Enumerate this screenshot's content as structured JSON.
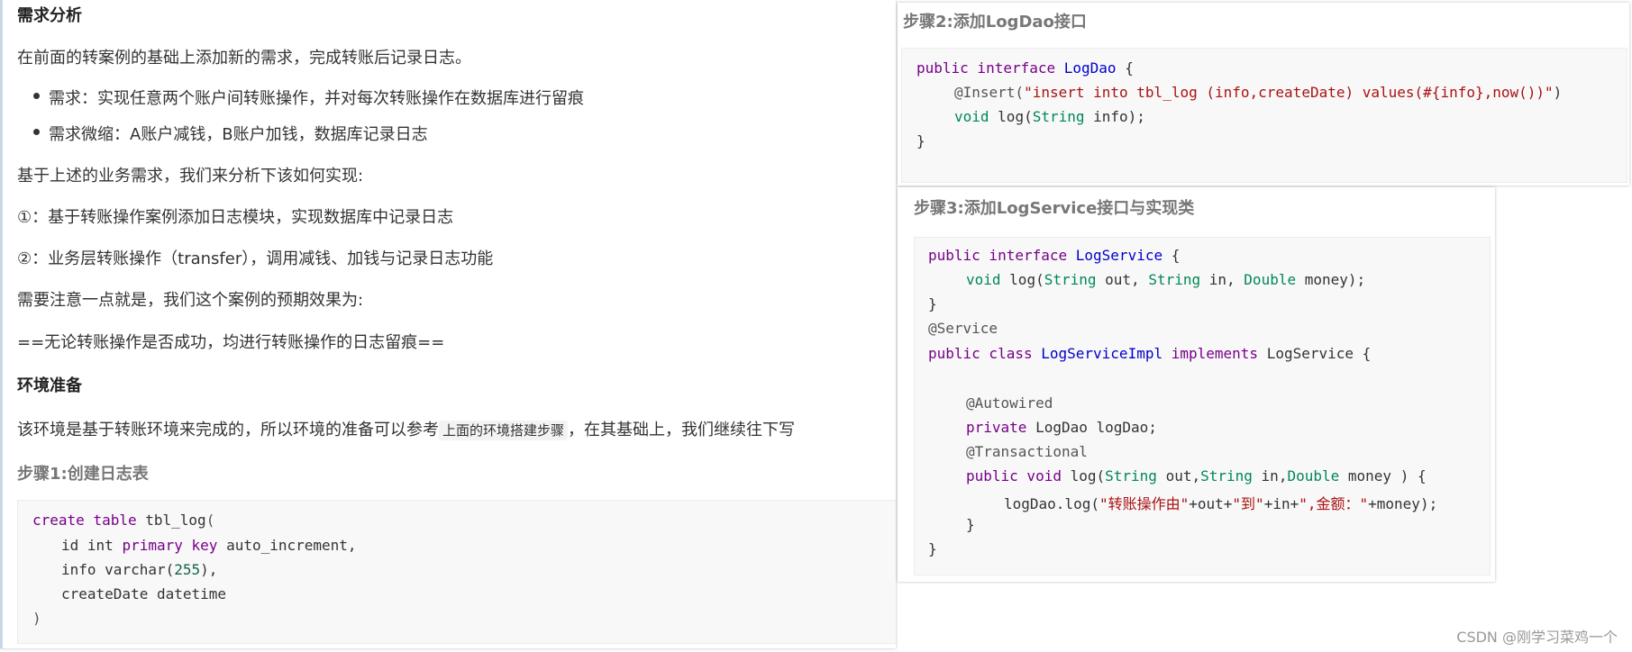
{
  "left": {
    "section_title": "需求分析",
    "intro": "在前面的转案例的基础上添加新的需求，完成转账后记录日志。",
    "bullets": [
      "需求：实现任意两个账户间转账操作，并对每次转账操作在数据库进行留痕",
      "需求微缩：A账户减钱，B账户加钱，数据库记录日志"
    ],
    "analysis_intro": "基于上述的业务需求，我们来分析下该如何实现:",
    "steps": [
      "①：基于转账操作案例添加日志模块，实现数据库中记录日志",
      "②：业务层转账操作（transfer），调用减钱、加钱与记录日志功能"
    ],
    "note_intro": "需要注意一点就是，我们这个案例的预期效果为:",
    "highlight": "==无论转账操作是否成功，均进行转账操作的日志留痕==",
    "env_title": "环境准备",
    "env_text_pre": "该环境是基于转账环境来完成的，所以环境的准备可以参考",
    "env_text_code": "上面的环境搭建步骤",
    "env_text_post": "，在其基础上，我们继续往下写",
    "step1_title": "步骤1:创建日志表",
    "sql": {
      "l1_kw1": "create",
      "l1_kw2": "table",
      "l1_name": "tbl_log",
      "l1_paren": "(",
      "l2_col": "id",
      "l2_type": "int",
      "l2_kw": "primary key",
      "l2_rest": "auto_increment,",
      "l3_col": "info",
      "l3_type": "varchar(",
      "l3_num": "255",
      "l3_close": "),",
      "l4": "createDate datetime",
      "l5": ")"
    }
  },
  "right_top": {
    "title": "步骤2:添加LogDao接口",
    "code": {
      "l1_kw": "public interface",
      "l1_name": "LogDao",
      "l1_brace": "{",
      "l2_ann": "@Insert(",
      "l2_str": "\"insert into tbl_log (info,createDate) values(#{info},now())\"",
      "l2_close": ")",
      "l3_kw": "void",
      "l3_rest": "log(",
      "l3_type": "String",
      "l3_end": "info);",
      "l4": "}"
    }
  },
  "right_mid": {
    "title": "步骤3:添加LogService接口与实现类",
    "code": {
      "l1_kw": "public interface",
      "l1_name": "LogService",
      "l1_brace": "{",
      "l2_kw": "void",
      "l2_a": "log(",
      "l2_t1": "String",
      "l2_b": "out,",
      "l2_t2": "String",
      "l2_c": "in,",
      "l2_t3": "Double",
      "l2_d": "money);",
      "l3": "}",
      "l4": "@Service",
      "l5_kw": "public class",
      "l5_name": "LogServiceImpl",
      "l5_kw2": "implements",
      "l5_rest": "LogService {",
      "l7": "@Autowired",
      "l8_kw": "private",
      "l8_rest": "LogDao logDao;",
      "l9": "@Transactional",
      "l10_kw": "public void",
      "l10_a": "log(",
      "l10_t1": "String",
      "l10_b": "out,",
      "l10_t2": "String",
      "l10_c": "in,",
      "l10_t3": "Double",
      "l10_d": "money ) {",
      "l11_a": "logDao.log(",
      "l11_s1": "\"转账操作由\"",
      "l11_b": "+out+",
      "l11_s2": "\"到\"",
      "l11_c": "+in+",
      "l11_s3": "\",金额：\"",
      "l11_d": "+money);",
      "l12": "}",
      "l13": "}"
    }
  },
  "watermark": "CSDN @刚学习菜鸡一个"
}
